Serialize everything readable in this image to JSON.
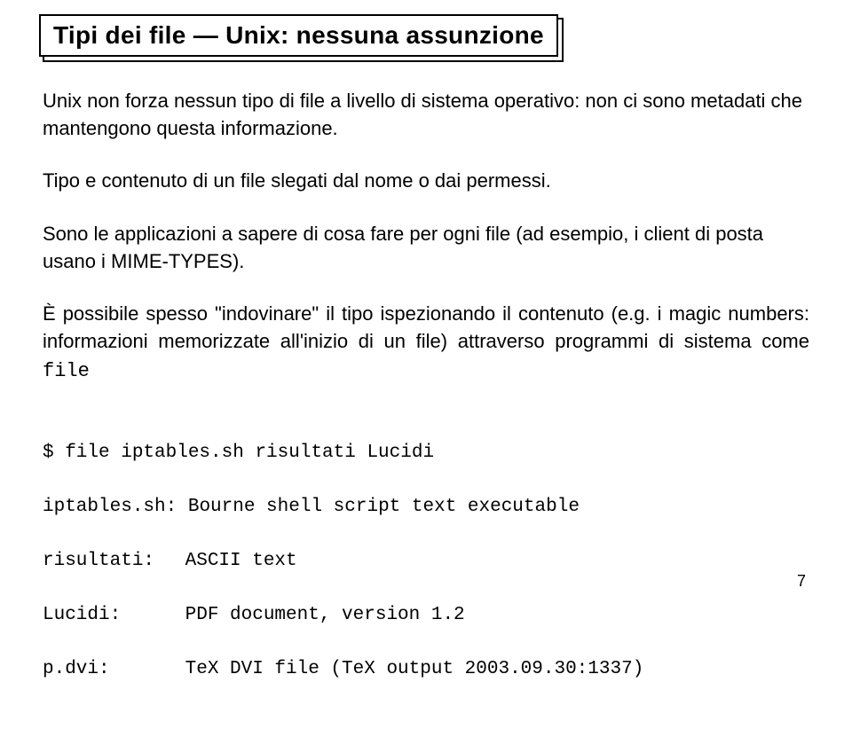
{
  "title": "Tipi dei file — Unix: nessuna assunzione",
  "para1": "Unix non forza nessun tipo di file a livello di sistema operativo: non ci sono metadati che mantengono questa informazione.",
  "para2": "Tipo e contenuto di un file slegati dal nome o dai permessi.",
  "para3": "Sono le applicazioni a sapere di cosa fare per ogni file (ad esempio, i client di posta usano i MIME-TYPES).",
  "para4_pre": "È possibile spesso \"indovinare\" il tipo ispezionando il contenuto (e.g. i magic numbers: informazioni memorizzate all'inizio di un file) attraverso programmi di sistema come ",
  "para4_tt": "file",
  "cmd": "$ file iptables.sh risultati Lucidi",
  "out": [
    {
      "name": "iptables.sh:",
      "desc": "Bourne shell script text executable"
    },
    {
      "name": "risultati:",
      "desc": "ASCII text"
    },
    {
      "name": "Lucidi:",
      "desc": "PDF document, version 1.2"
    },
    {
      "name": "p.dvi:",
      "desc": "TeX DVI file (TeX output 2003.09.30:1337)"
    }
  ],
  "page_number": "7"
}
